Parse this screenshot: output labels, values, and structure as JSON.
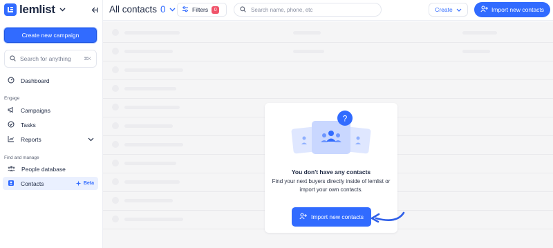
{
  "brand": {
    "name": "lemlist"
  },
  "sidebar": {
    "create_campaign_label": "Create new campaign",
    "search_placeholder": "Search for anything",
    "search_shortcut": "⌘K",
    "dashboard_label": "Dashboard",
    "engage_section": "Engage",
    "engage_items": [
      "Campaigns",
      "Tasks",
      "Reports"
    ],
    "find_section": "Find and manage",
    "people_label": "People database",
    "contacts_label": "Contacts",
    "beta_label": "Beta"
  },
  "header": {
    "title": "All contacts",
    "count": "0",
    "filters_label": "Filters",
    "filters_count": "0",
    "search_placeholder": "Search name, phone, etc",
    "create_label": "Create",
    "import_label": "Import new contacts"
  },
  "empty_state": {
    "question_mark": "?",
    "title": "You don't have any contacts",
    "description": "Find your next buyers directly inside of lemlist or import your own contacts.",
    "button_label": "Import new contacts"
  },
  "colors": {
    "accent": "#316bff",
    "badge": "#f0536a",
    "main_bg": "#f5f5f6"
  }
}
